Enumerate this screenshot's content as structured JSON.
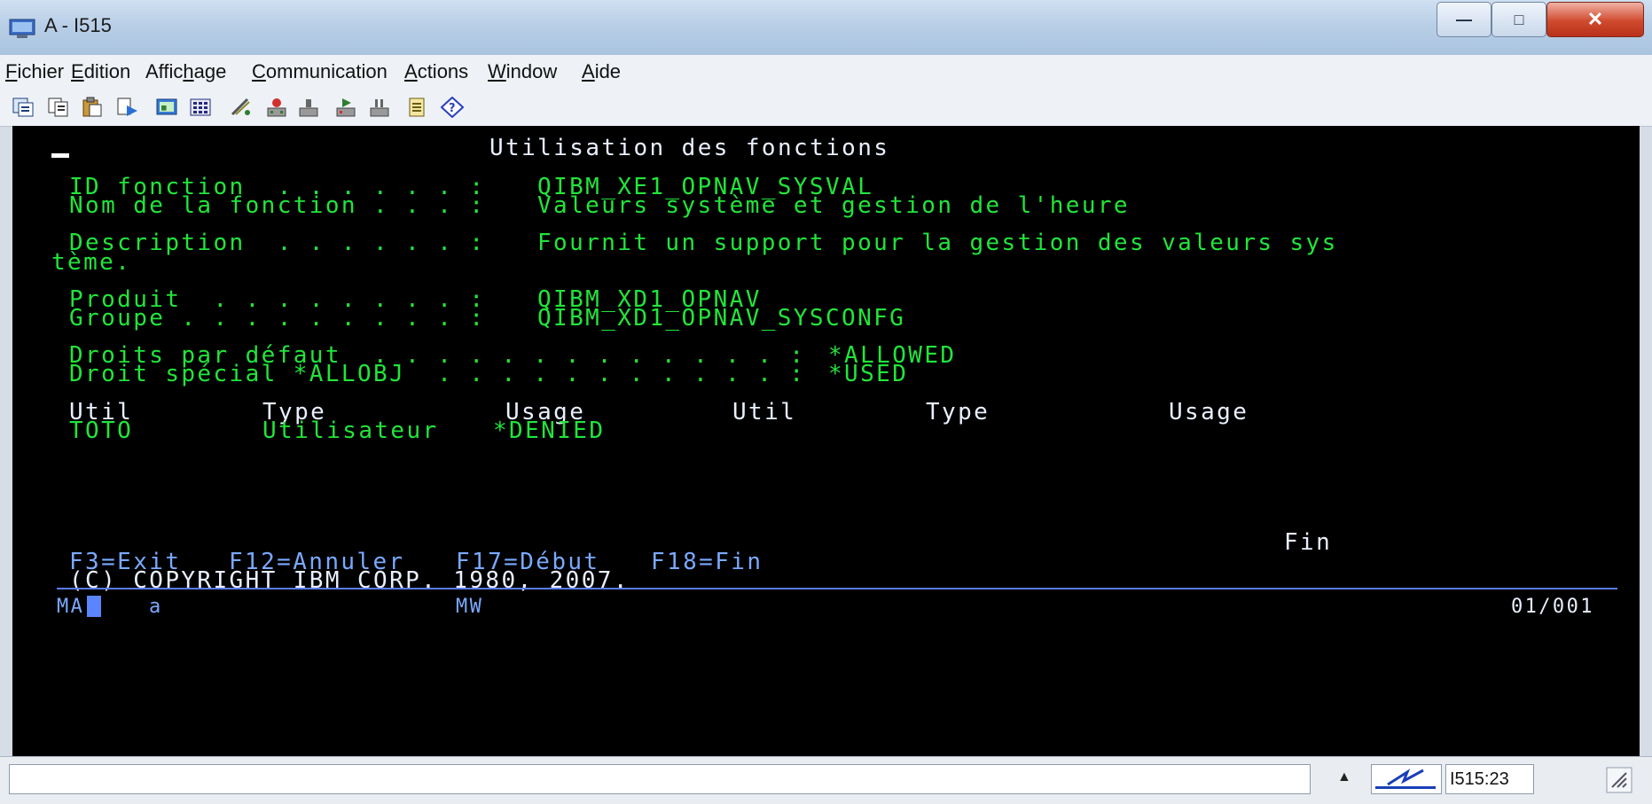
{
  "window": {
    "title": "A - I515",
    "min_glyph": "—",
    "max_glyph": "□",
    "close_glyph": "✕"
  },
  "menu": [
    {
      "pre": "",
      "u": "F",
      "post": "ichier"
    },
    {
      "pre": "",
      "u": "E",
      "post": "dition"
    },
    {
      "pre": "Affic",
      "u": "h",
      "post": "age"
    },
    {
      "pre": "",
      "u": "C",
      "post": "ommunication"
    },
    {
      "pre": "",
      "u": "A",
      "post": "ctions"
    },
    {
      "pre": "",
      "u": "W",
      "post": "indow"
    },
    {
      "pre": "",
      "u": "A",
      "post": "ide"
    }
  ],
  "toolbar_icons": [
    "copy-screen-icon",
    "copy-icon",
    "paste-icon",
    "send-icon",
    "display-icon",
    "keypad-icon",
    "macro-icon",
    "record-icon",
    "stop-icon",
    "play-icon",
    "pause-icon",
    "notepad-icon",
    "help-icon"
  ],
  "terminal": {
    "heading": "Utilisation des fonctions",
    "id_label": "ID fonction  . . . . . . :",
    "id_value": "QIBM_XE1_OPNAV_SYSVAL",
    "name_label": "Nom de la fonction . . . :",
    "name_value": "Valeurs système et gestion de l'heure",
    "desc_label": "Description  . . . . . . :",
    "desc_value": "Fournit un support pour la gestion des valeurs sys",
    "desc_wrap": "tème.",
    "prod_label": "Produit  . . . . . . . . :",
    "prod_value": "QIBM_XD1_OPNAV",
    "group_label": "Groupe . . . . . . . . . :",
    "group_value": "QIBM_XD1_OPNAV_SYSCONFG",
    "default_label": "Droits par défaut  . . . . . . . . . . . . . :",
    "default_value": "*ALLOWED",
    "special_label": "Droit spécial *ALLOBJ  . . . . . . . . . . . :",
    "special_value": "*USED",
    "col_util": "Util",
    "col_type": "Type",
    "col_usage": "Usage",
    "col_util2": "Util",
    "col_type2": "Type",
    "col_usage2": "Usage",
    "row_util": "TOTO",
    "row_type": "Utilisateur",
    "row_usage": "*DENIED",
    "more_indicator": "Fin",
    "fkey_f3": "F3=Exit",
    "fkey_f12": "F12=Annuler",
    "fkey_f17": "F17=Début",
    "fkey_f18": "F18=Fin",
    "copyright": "(C) COPYRIGHT IBM CORP. 1980, 2007.",
    "oia_left": "MA",
    "oia_a": "a",
    "oia_mw": "MW",
    "oia_pos": "01/001"
  },
  "statusbar": {
    "arrow": "▲",
    "session": "I515:23"
  }
}
